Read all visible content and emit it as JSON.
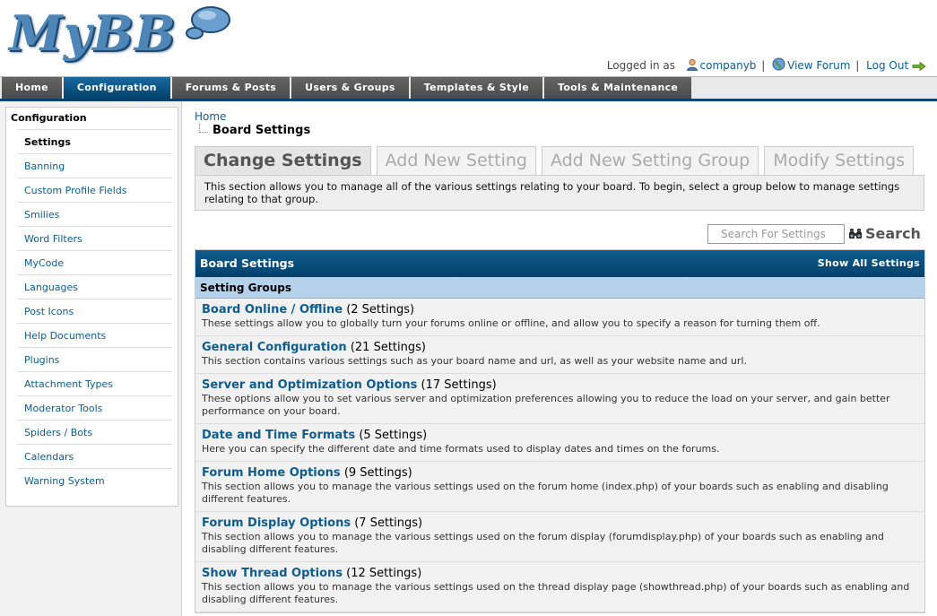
{
  "logo": {
    "text": "MyBB"
  },
  "welcome": {
    "prefix": "Logged in as",
    "username": "companyb",
    "view_forum": "View Forum",
    "logout": "Log Out"
  },
  "menu": [
    {
      "label": "Home",
      "active": false
    },
    {
      "label": "Configuration",
      "active": true
    },
    {
      "label": "Forums & Posts",
      "active": false
    },
    {
      "label": "Users & Groups",
      "active": false
    },
    {
      "label": "Templates & Style",
      "active": false
    },
    {
      "label": "Tools & Maintenance",
      "active": false
    }
  ],
  "sidebar": {
    "title": "Configuration",
    "items": [
      {
        "label": "Settings",
        "active": true
      },
      {
        "label": "Banning"
      },
      {
        "label": "Custom Profile Fields"
      },
      {
        "label": "Smilies"
      },
      {
        "label": "Word Filters"
      },
      {
        "label": "MyCode"
      },
      {
        "label": "Languages"
      },
      {
        "label": "Post Icons"
      },
      {
        "label": "Help Documents"
      },
      {
        "label": "Plugins"
      },
      {
        "label": "Attachment Types"
      },
      {
        "label": "Moderator Tools"
      },
      {
        "label": "Spiders / Bots"
      },
      {
        "label": "Calendars"
      },
      {
        "label": "Warning System"
      }
    ]
  },
  "breadcrumb": {
    "home": "Home",
    "current": "Board Settings"
  },
  "tabs": [
    {
      "label": "Change Settings",
      "active": true
    },
    {
      "label": "Add New Setting"
    },
    {
      "label": "Add New Setting Group"
    },
    {
      "label": "Modify Settings"
    }
  ],
  "tab_description": "This section allows you to manage all of the various settings relating to your board. To begin, select a group below to manage settings relating to that group.",
  "search": {
    "placeholder": "Search For Settings",
    "button": "Search"
  },
  "table": {
    "header": "Board Settings",
    "header_link": "Show All Settings",
    "subheader": "Setting Groups",
    "rows": [
      {
        "name": "Board Online / Offline",
        "count": "(2 Settings)",
        "desc": "These settings allow you to globally turn your forums online or offline, and allow you to specify a reason for turning them off."
      },
      {
        "name": "General Configuration",
        "count": "(21 Settings)",
        "desc": "This section contains various settings such as your board name and url, as well as your website name and url."
      },
      {
        "name": "Server and Optimization Options",
        "count": "(17 Settings)",
        "desc": "These options allow you to set various server and optimization preferences allowing you to reduce the load on your server, and gain better performance on your board."
      },
      {
        "name": "Date and Time Formats",
        "count": "(5 Settings)",
        "desc": "Here you can specify the different date and time formats used to display dates and times on the forums."
      },
      {
        "name": "Forum Home Options",
        "count": "(9 Settings)",
        "desc": "This section allows you to manage the various settings used on the forum home (index.php) of your boards such as enabling and disabling different features."
      },
      {
        "name": "Forum Display Options",
        "count": "(7 Settings)",
        "desc": "This section allows you to manage the various settings used on the forum display (forumdisplay.php) of your boards such as enabling and disabling different features."
      },
      {
        "name": "Show Thread Options",
        "count": "(12 Settings)",
        "desc": "This section allows you to manage the various settings used on the thread display page (showthread.php) of your boards such as enabling and disabling different features."
      }
    ]
  }
}
